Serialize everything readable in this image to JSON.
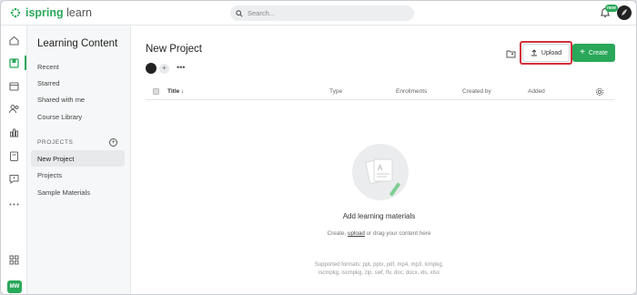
{
  "header": {
    "logo_part1": "ispring",
    "logo_part2": "learn",
    "search_placeholder": "Search...",
    "badge": "new",
    "avatar_initials": ""
  },
  "rail": {
    "user_initials": "MW"
  },
  "nav": {
    "title": "Learning Content",
    "items": [
      "Recent",
      "Starred",
      "Shared with me",
      "Course Library"
    ],
    "section_label": "PROJECTS",
    "projects": [
      "New Project",
      "Projects",
      "Sample Materials"
    ]
  },
  "main": {
    "title": "New Project",
    "upload_label": "Upload",
    "create_label": "Create",
    "columns": {
      "title": "Title",
      "type": "Type",
      "enrollments": "Enrollments",
      "created_by": "Created by",
      "added": "Added"
    },
    "empty": {
      "heading": "Add learning materials",
      "hint_prefix": "Create,",
      "hint_link": "upload",
      "hint_suffix": "or drag your content here",
      "formats_line1": "Supported formats: ppt, pptx, pdf, mp4, mp3, lcmpkg,",
      "formats_line2": "iscmpkg, iscmpkg, zip, swf, flv, doc, docx, xls, xlsx"
    }
  },
  "colors": {
    "accent": "#2aa85a",
    "highlight": "#d3303a"
  }
}
